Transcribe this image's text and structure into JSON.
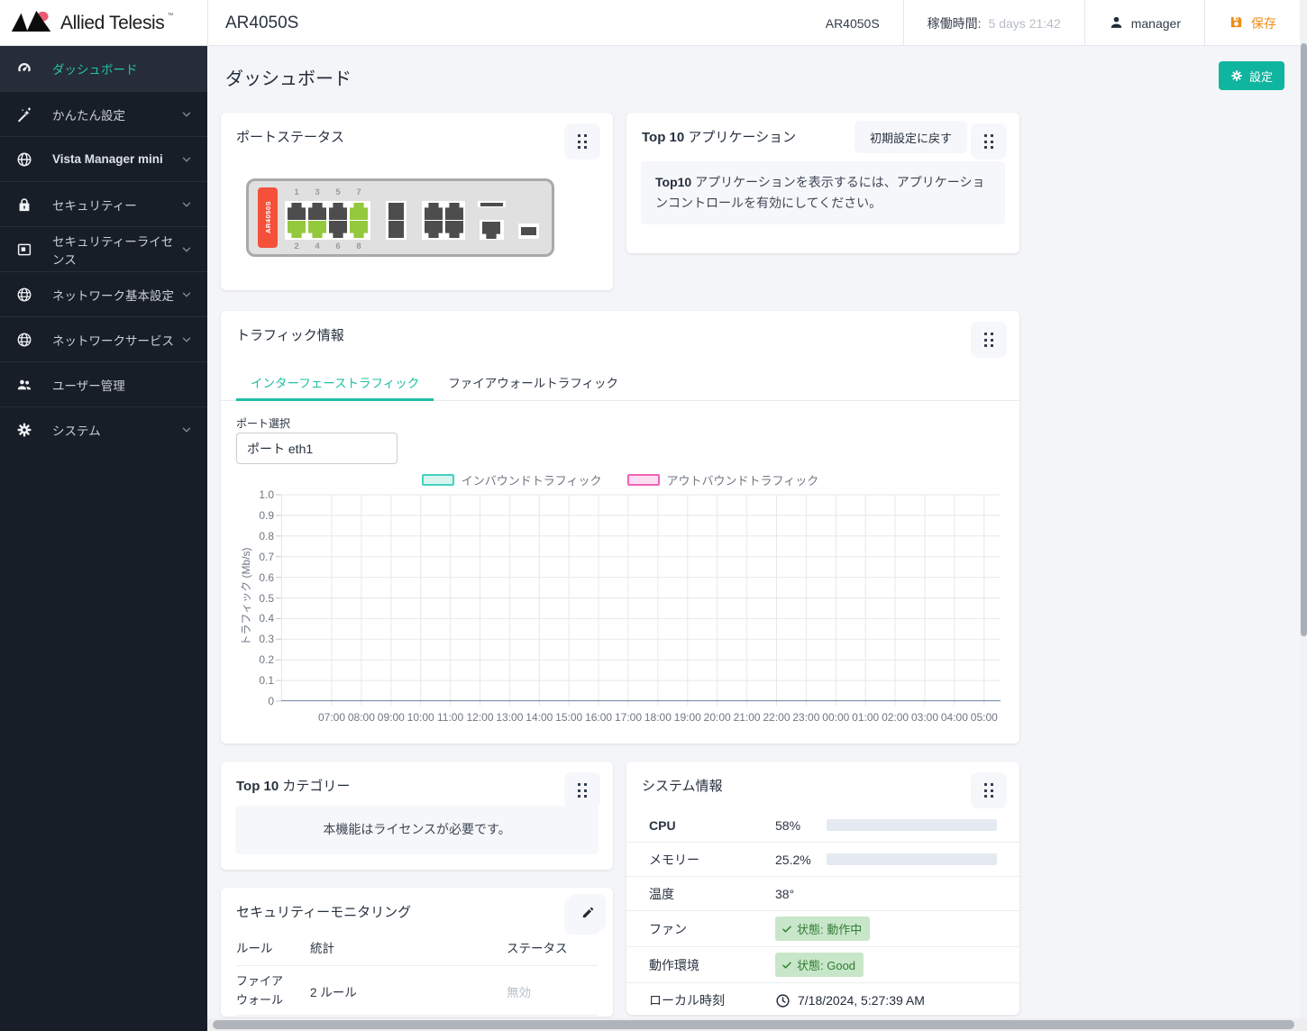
{
  "header": {
    "brand": "Allied Telesis",
    "page_title": "AR4050S",
    "device_name": "AR4050S",
    "uptime_label": "稼働時間:",
    "uptime_value": "5 days 21:42",
    "user": "manager",
    "save_label": "保存"
  },
  "sidebar": {
    "items": [
      {
        "label": "ダッシュボード"
      },
      {
        "label": "かんたん設定"
      },
      {
        "label": "Vista Manager mini"
      },
      {
        "label": "セキュリティー"
      },
      {
        "label": "セキュリティーライセンス"
      },
      {
        "label": "ネットワーク基本設定"
      },
      {
        "label": "ネットワークサービス"
      },
      {
        "label": "ユーザー管理"
      },
      {
        "label": "システム"
      }
    ]
  },
  "page": {
    "title": "ダッシュボード",
    "settings_button": "設定"
  },
  "cards": {
    "port_status": {
      "title": "ポートステータス",
      "device_label": "AR4050S",
      "numbers_top": [
        "1",
        "3",
        "5",
        "7"
      ],
      "numbers_bottom": [
        "2",
        "4",
        "6",
        "8"
      ],
      "states_top": [
        "down",
        "down",
        "down",
        "up"
      ],
      "states_bottom": [
        "up",
        "up",
        "down",
        "up"
      ],
      "port_up_color": "#94c83d",
      "port_down_color": "#4d4d4d"
    },
    "top10_apps": {
      "title_strong": "Top 10",
      "title_rest": " アプリケーション",
      "reset_button": "初期設定に戻す",
      "message_strong": "Top10",
      "message_rest": " アプリケーションを表示するには、アプリケーションコントロールを有効にしてください。"
    },
    "traffic": {
      "title": "トラフィック情報",
      "tabs": [
        {
          "label": "インターフェーストラフィック"
        },
        {
          "label": "ファイアウォールトラフィック"
        }
      ],
      "port_select_label": "ポート選択",
      "port_select_value": "ポート eth1",
      "legend": [
        {
          "label": "インバウンドトラフィック",
          "color": "#45d1bf",
          "fill": "#d8f5ef"
        },
        {
          "label": "アウトバウンドトラフィック",
          "color": "#ee64b4",
          "fill": "#fbdef1"
        }
      ]
    },
    "top10_categories": {
      "title_strong": "Top 10",
      "title_rest": " カテゴリー",
      "message": "本機能はライセンスが必要です。"
    },
    "system_info": {
      "title": "システム情報",
      "cpu_label": "CPU",
      "cpu_value": "58%",
      "cpu_percent": 58,
      "memory_label": "メモリー",
      "memory_value": "25.2%",
      "memory_percent": 25.2,
      "temp_label": "温度",
      "temp_value": "38°",
      "fan_label": "ファン",
      "fan_status": "状態: 動作中",
      "env_label": "動作環境",
      "env_status": "状態: Good",
      "time_label": "ローカル時刻",
      "time_value": "7/18/2024, 5:27:39 AM"
    },
    "security": {
      "title": "セキュリティーモニタリング",
      "columns": [
        "ルール",
        "統計",
        "ステータス"
      ],
      "rows": [
        {
          "rule": "ファイアウォール",
          "stat": "2 ルール",
          "status": "無効"
        }
      ]
    }
  },
  "chart_data": {
    "type": "line",
    "title": "",
    "xlabel": "",
    "ylabel": "トラフィック (Mb/s)",
    "ylim": [
      0,
      1.0
    ],
    "yticks": [
      "0",
      "0.1",
      "0.2",
      "0.3",
      "0.4",
      "0.5",
      "0.6",
      "0.7",
      "0.8",
      "0.9",
      "1.0"
    ],
    "x": [
      "07:00",
      "08:00",
      "09:00",
      "10:00",
      "11:00",
      "12:00",
      "13:00",
      "14:00",
      "15:00",
      "16:00",
      "17:00",
      "18:00",
      "19:00",
      "20:00",
      "21:00",
      "22:00",
      "23:00",
      "00:00",
      "01:00",
      "02:00",
      "03:00",
      "04:00",
      "05:00"
    ],
    "series": [
      {
        "name": "インバウンドトラフィック",
        "values": []
      },
      {
        "name": "アウトバウンドトラフィック",
        "values": []
      }
    ],
    "grid": true,
    "legend_position": "top"
  }
}
